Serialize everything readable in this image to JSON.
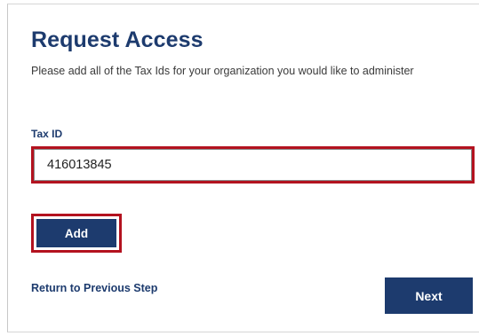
{
  "page": {
    "title": "Request Access",
    "subtitle": "Please add all of the Tax Ids for your organization you would like to administer"
  },
  "form": {
    "tax_id_label": "Tax ID",
    "tax_id_value": "416013845",
    "add_label": "Add"
  },
  "footer": {
    "back_link": "Return to Previous Step",
    "next_label": "Next"
  },
  "colors": {
    "brand_navy": "#1d3b6e",
    "highlight_red": "#b3121f"
  }
}
